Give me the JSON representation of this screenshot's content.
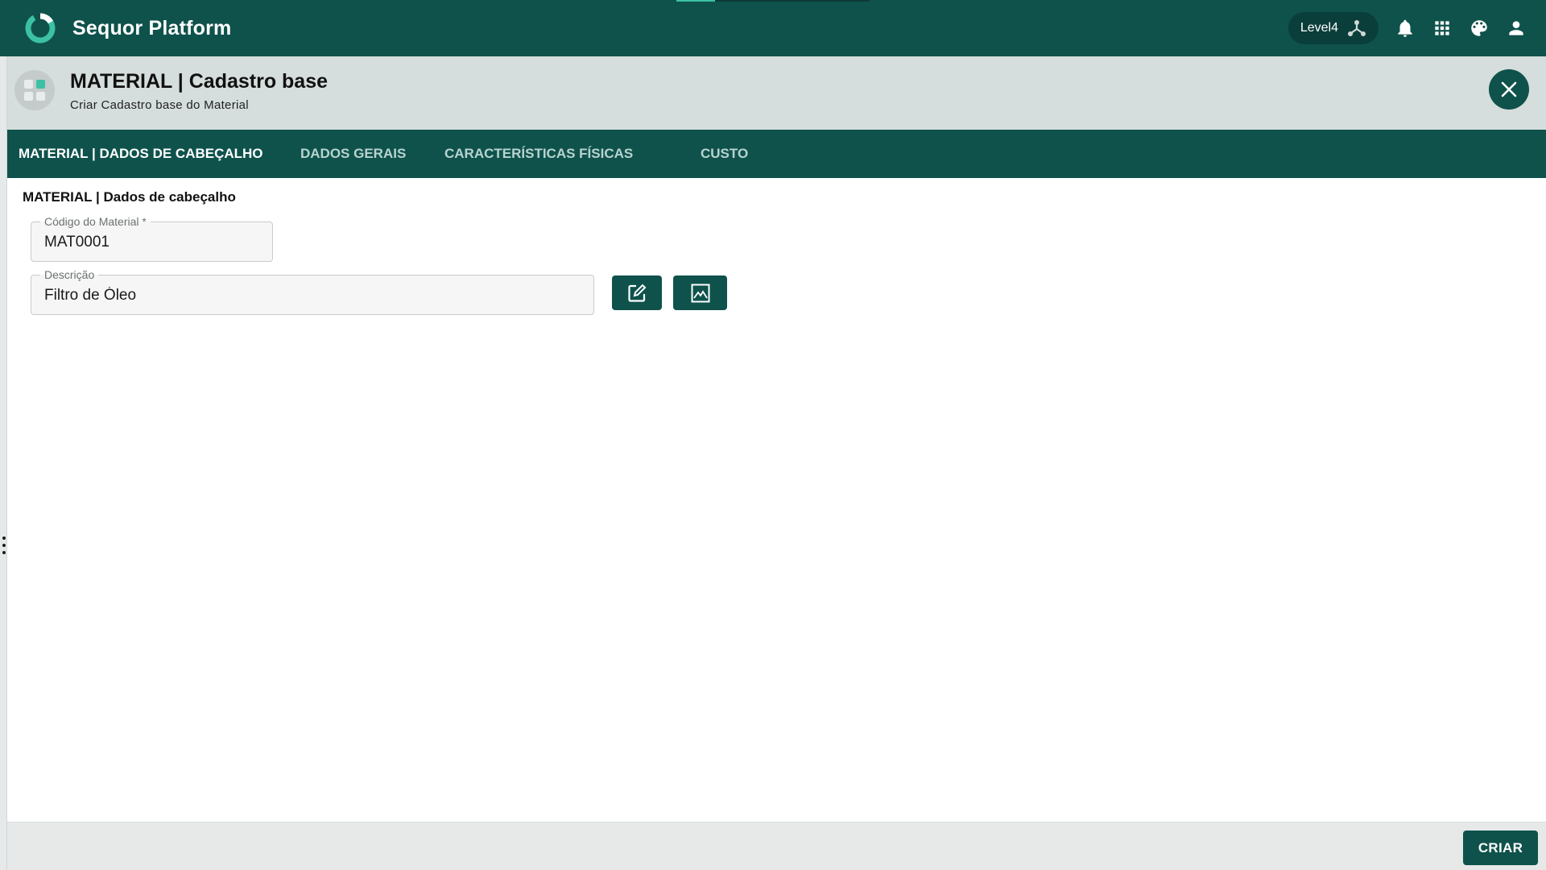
{
  "app": {
    "name": "Sequor Platform",
    "level": "Level4"
  },
  "top_icons": [
    "org-tree-icon",
    "bell-icon",
    "apps-grid-icon",
    "palette-icon",
    "user-icon"
  ],
  "page": {
    "title": "MATERIAL | Cadastro base",
    "subtitle": "Criar Cadastro base do Material"
  },
  "tabs": [
    {
      "label": "MATERIAL | DADOS DE CABEÇALHO",
      "active": true
    },
    {
      "label": "DADOS GERAIS",
      "active": false
    },
    {
      "label": "CARACTERÍSTICAS FÍSICAS",
      "active": false
    },
    {
      "label": "CUSTO",
      "active": false
    }
  ],
  "form": {
    "section_title": "MATERIAL | Dados de cabeçalho",
    "material_code": {
      "label": "Código do Material *",
      "value": "MAT0001"
    },
    "description": {
      "label": "Descrição",
      "value": "Filtro de Óleo"
    }
  },
  "footer": {
    "create_label": "CRIAR"
  },
  "colors": {
    "primary": "#0f524c",
    "accent": "#3cc1a4",
    "header_bg": "#d5dedc",
    "footer_bg": "#e7e9e9"
  }
}
